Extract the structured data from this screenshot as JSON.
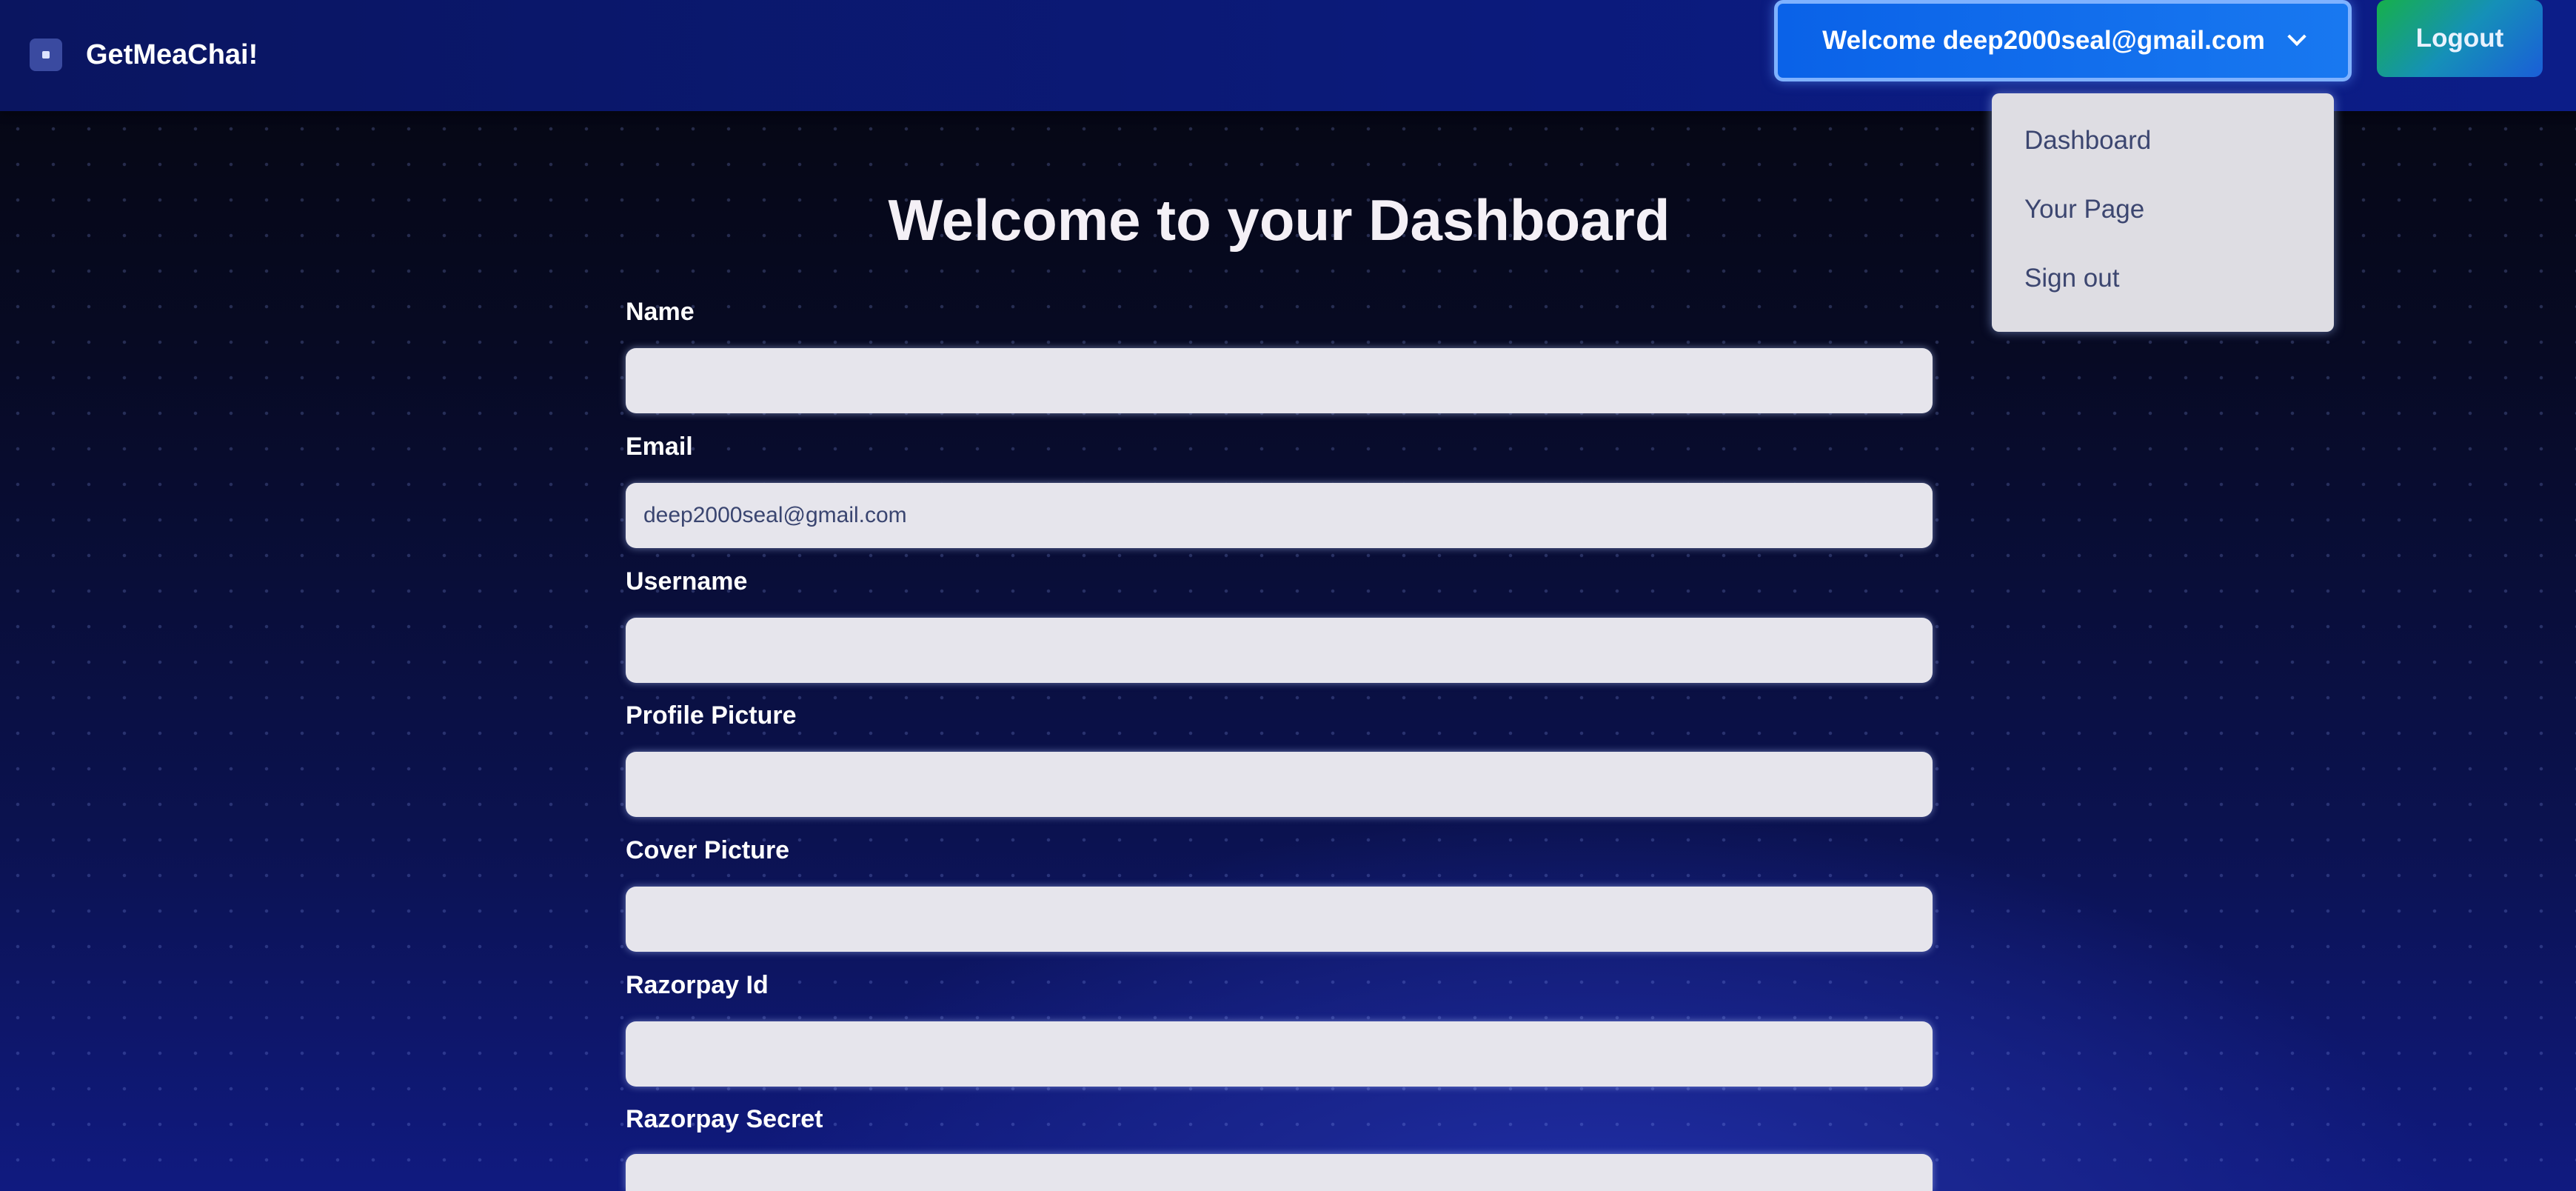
{
  "navbar": {
    "brand": "GetMeaChai!",
    "user_menu_label": "Welcome deep2000seal@gmail.com",
    "logout_label": "Logout"
  },
  "dropdown": {
    "items": [
      {
        "label": "Dashboard"
      },
      {
        "label": "Your Page"
      },
      {
        "label": "Sign out"
      }
    ]
  },
  "main": {
    "title": "Welcome to your Dashboard",
    "fields": [
      {
        "label": "Name",
        "value": "",
        "placeholder": ""
      },
      {
        "label": "Email",
        "value": "deep2000seal@gmail.com",
        "placeholder": ""
      },
      {
        "label": "Username",
        "value": "",
        "placeholder": ""
      },
      {
        "label": "Profile Picture",
        "value": "",
        "placeholder": ""
      },
      {
        "label": "Cover Picture",
        "value": "",
        "placeholder": ""
      },
      {
        "label": "Razorpay Id",
        "value": "",
        "placeholder": ""
      },
      {
        "label": "Razorpay Secret",
        "value": "",
        "placeholder": ""
      }
    ]
  },
  "colors": {
    "navbar_bg": "#0b1a7a",
    "welcome_button": "#0a62e8",
    "logout_gradient_start": "#16b04a",
    "logout_gradient_end": "#1a5ed8",
    "input_bg": "#e6e5ec",
    "dropdown_bg": "#dedde3"
  },
  "icons": {
    "logo": "square-logo-icon",
    "user_menu_toggle": "chevron-down-icon"
  }
}
